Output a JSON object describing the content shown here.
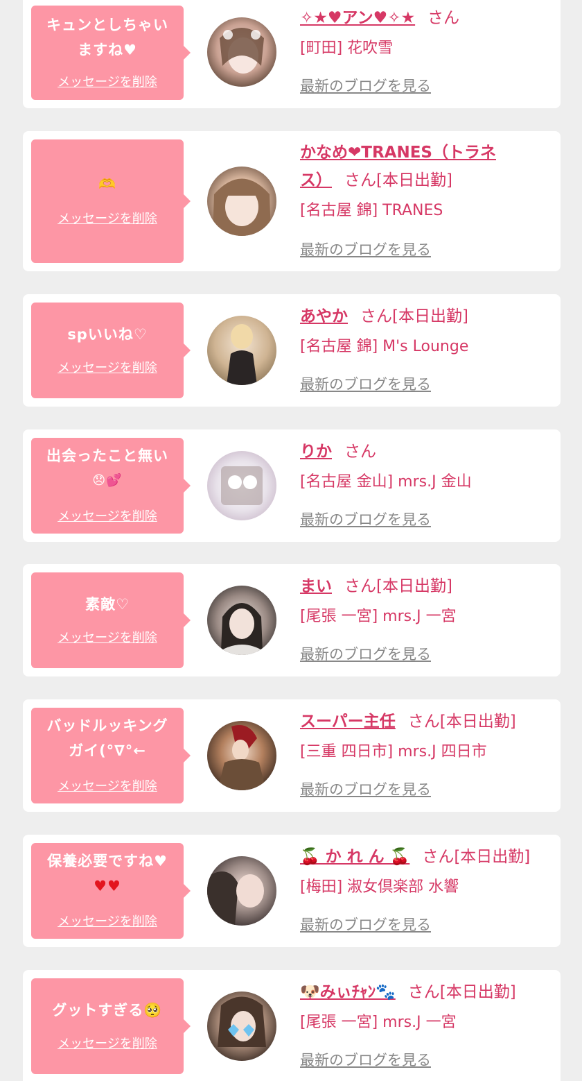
{
  "colors": {
    "page_bg": "#eeeeee",
    "card_bg": "#ffffff",
    "bubble_bg": "#fd96a5",
    "accent": "#d63865",
    "muted": "#888888"
  },
  "delete_label": "メッセージを削除",
  "blog_label": "最新のブログを見る",
  "items": [
    {
      "message_line1": "キュンとしちゃい",
      "message_line2": "ますね♥",
      "name": "✧★♥アン♥✧★",
      "suffix": "さん",
      "name_line2": "",
      "suffix2": "",
      "shop": "[町田] 花吹雪"
    },
    {
      "message_line1": "🫶",
      "message_line2": "",
      "name": "かなめ❤TRANES（トラネ",
      "suffix": "",
      "name_line2": "ス）",
      "suffix2": "さん[本日出勤]",
      "shop": "[名古屋 錦] TRANES"
    },
    {
      "message_line1": "spいいね♡",
      "message_line2": "",
      "name": "あやか",
      "suffix": "さん[本日出勤]",
      "name_line2": "",
      "suffix2": "",
      "shop": "[名古屋 錦] M's Lounge"
    },
    {
      "message_line1": "出会ったこと無い",
      "message_line2": "😞💕",
      "name": "りか",
      "suffix": "さん",
      "name_line2": "",
      "suffix2": "",
      "shop": "[名古屋 金山] mrs.J 金山"
    },
    {
      "message_line1": "素敵♡",
      "message_line2": "",
      "name": "まい",
      "suffix": "さん[本日出勤]",
      "name_line2": "",
      "suffix2": "",
      "shop": "[尾張 一宮] mrs.J 一宮"
    },
    {
      "message_line1": "バッドルッキング",
      "message_line2": "ガイ(°∇°←",
      "name": "スーパー主任",
      "suffix": "さん[本日出勤]",
      "name_line2": "",
      "suffix2": "",
      "shop": "[三重 四日市] mrs.J 四日市"
    },
    {
      "message_line1": "保養必要ですね♥",
      "message_line2": "♥♥",
      "name": "🍒 か れ ん 🍒",
      "suffix": "さん[本日出勤]",
      "name_line2": "",
      "suffix2": "",
      "shop": "[梅田] 淑女倶楽部 水響"
    },
    {
      "message_line1": "グットすぎる🥺",
      "message_line2": "",
      "name": "🐶みぃﾁｬﾝ🐾",
      "suffix": "さん[本日出勤]",
      "name_line2": "",
      "suffix2": "",
      "shop": "[尾張 一宮] mrs.J 一宮"
    }
  ]
}
